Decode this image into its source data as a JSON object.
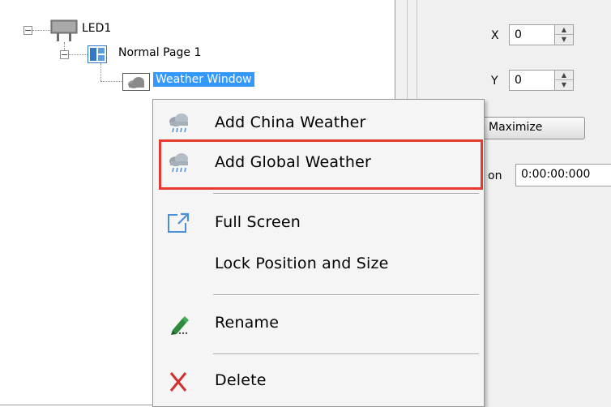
{
  "tree": {
    "items": [
      {
        "label": "LED1",
        "expander": "−",
        "icon": "led-screen-icon"
      },
      {
        "label": "Normal Page 1",
        "expander": "−",
        "icon": "page-layout-icon"
      },
      {
        "label": "Weather Window",
        "icon": "cloud-window-icon",
        "selected": true
      }
    ]
  },
  "properties": {
    "x_label": "X",
    "x_value": "0",
    "y_label": "Y",
    "y_value": "0",
    "maximize_label": "Maximize",
    "duration_label_partial": "on",
    "duration_value": "0:00:00:000"
  },
  "context_menu": {
    "items": [
      {
        "label": "Add China Weather",
        "icon": "weather-cloud-icon"
      },
      {
        "label": "Add Global Weather",
        "icon": "weather-cloud-icon",
        "highlighted": true
      },
      {
        "label": "Full Screen",
        "icon": "full-screen-icon"
      },
      {
        "label": "Lock Position and Size"
      },
      {
        "label": "Rename",
        "icon": "pencil-icon"
      },
      {
        "label": "Delete",
        "icon": "delete-x-icon"
      }
    ]
  },
  "colors": {
    "selection": "#3399ff",
    "highlight_border": "#e8392e",
    "delete_icon": "#d32f2f",
    "full_screen_icon": "#4a90d9",
    "pencil_icon": "#2e8b3e"
  }
}
